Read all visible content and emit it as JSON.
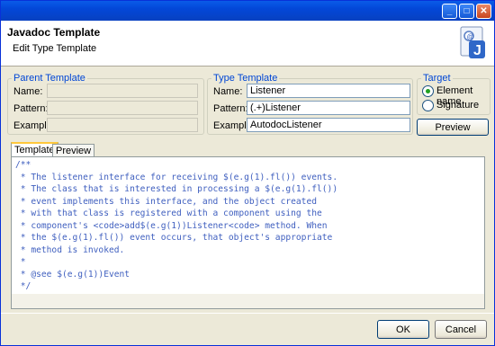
{
  "dialog": {
    "title": "Javadoc Template",
    "subtitle": "Edit Type Template",
    "window_buttons": [
      "minimize",
      "maximize",
      "close"
    ]
  },
  "parent_template": {
    "legend": "Parent Template",
    "name_label": "Name:",
    "pattern_label": "Pattern:",
    "example_label": "Example:",
    "name_value": "",
    "pattern_value": "",
    "example_value": ""
  },
  "type_template": {
    "legend": "Type Template",
    "name_label": "Name:",
    "pattern_label": "Pattern:",
    "example_label": "Example:",
    "name_value": "Listener",
    "pattern_value": "(.+)Listener",
    "example_value": "AutodocListener"
  },
  "target": {
    "legend": "Target",
    "options": [
      {
        "label": "Element name",
        "selected": true
      },
      {
        "label": "Signature",
        "selected": false
      }
    ]
  },
  "preview_button": "Preview",
  "tabs": [
    {
      "label": "Template",
      "active": true
    },
    {
      "label": "Preview",
      "active": false
    }
  ],
  "editor": {
    "lines": [
      "/**",
      " * The listener interface for receiving $(e.g(1).fl()) events.",
      " * The class that is interested in processing a $(e.g(1).fl())",
      " * event implements this interface, and the object created",
      " * with that class is registered with a component using the",
      " * component's <code>add$(e.g(1))Listener<code> method. When",
      " * the $(e.g(1).fl()) event occurs, that object's appropriate",
      " * method is invoked.",
      " *",
      " * @see $(e.g(1))Event",
      " */"
    ]
  },
  "footer": {
    "ok": "OK",
    "cancel": "Cancel"
  },
  "colors": {
    "title_bar": "#0a5ce8",
    "legend_text": "#0046d5",
    "code_text": "#3f5fbf",
    "radio_selected": "#21a121"
  }
}
